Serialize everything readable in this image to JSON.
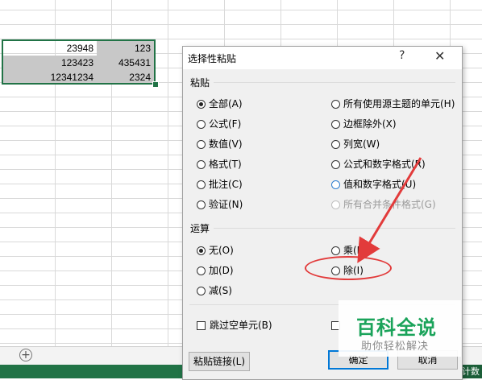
{
  "sheet": {
    "rows": [
      {
        "a": "23948",
        "b": "123"
      },
      {
        "a": "123423",
        "b": "435431"
      },
      {
        "a": "12341234",
        "b": "2324"
      }
    ],
    "status_text": "计数",
    "add_sheet_symbol": "+"
  },
  "dialog": {
    "title": "选择性粘贴",
    "help_symbol": "?",
    "close_symbol": "✕",
    "paste_section": "粘贴",
    "paste_options_left": [
      "全部(A)",
      "公式(F)",
      "数值(V)",
      "格式(T)",
      "批注(C)",
      "验证(N)"
    ],
    "paste_options_right": [
      "所有使用源主题的单元(H)",
      "边框除外(X)",
      "列宽(W)",
      "公式和数字格式(R)",
      "值和数字格式(U)",
      "所有合并条件格式(G)"
    ],
    "operation_section": "运算",
    "operation_left": [
      "无(O)",
      "加(D)",
      "减(S)"
    ],
    "operation_right": [
      "乘(M)",
      "除(I)"
    ],
    "skip_blanks": "跳过空单元(B)",
    "paste_link_button": "粘贴链接(L)",
    "ok_button": "确定",
    "cancel_button": "取消"
  },
  "watermark": {
    "title": "百科全说",
    "subtitle": "助你轻松解决"
  },
  "colors": {
    "excel_green": "#217346",
    "annotation_red": "#e23b3b",
    "watermark_green": "#1aa35a"
  }
}
